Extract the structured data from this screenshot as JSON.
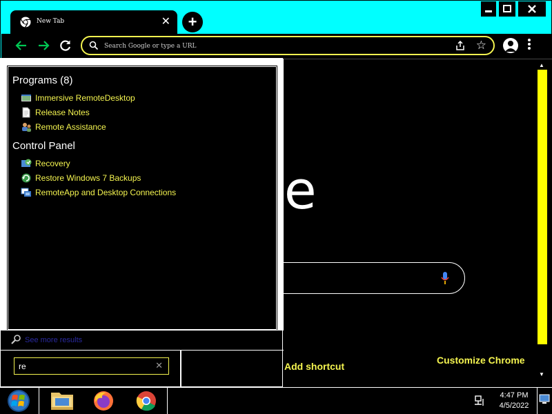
{
  "browser": {
    "tab_title": "New Tab",
    "omnibox_placeholder": "Search Google or type a URL",
    "ntp": {
      "add_shortcut": "Add shortcut",
      "customize": "Customize Chrome",
      "logo_text": "ogle"
    }
  },
  "start_menu": {
    "groups": [
      {
        "heading": "Programs (8)",
        "items": [
          {
            "label": "Immersive RemoteDesktop",
            "icon": "program-icon"
          },
          {
            "label": "Release Notes",
            "icon": "document-icon"
          },
          {
            "label": "Remote Assistance",
            "icon": "remote-assistance-icon"
          }
        ]
      },
      {
        "heading": "Control Panel",
        "items": [
          {
            "label": "Recovery",
            "icon": "recovery-icon"
          },
          {
            "label": "Restore Windows 7 Backups",
            "icon": "backup-icon"
          },
          {
            "label": "RemoteApp and Desktop Connections",
            "icon": "remoteapp-icon"
          }
        ]
      }
    ],
    "see_more": "See more results",
    "search_value": "re"
  },
  "taskbar": {
    "apps": [
      "file-explorer-icon",
      "firefox-icon",
      "chrome-icon"
    ],
    "time": "4:47 PM",
    "date": "4/5/2022"
  },
  "colors": {
    "frame": "#00ffff",
    "link_yellow": "#f5f550",
    "scroll_thumb": "#ffff00",
    "nav_green": "#00c853"
  }
}
